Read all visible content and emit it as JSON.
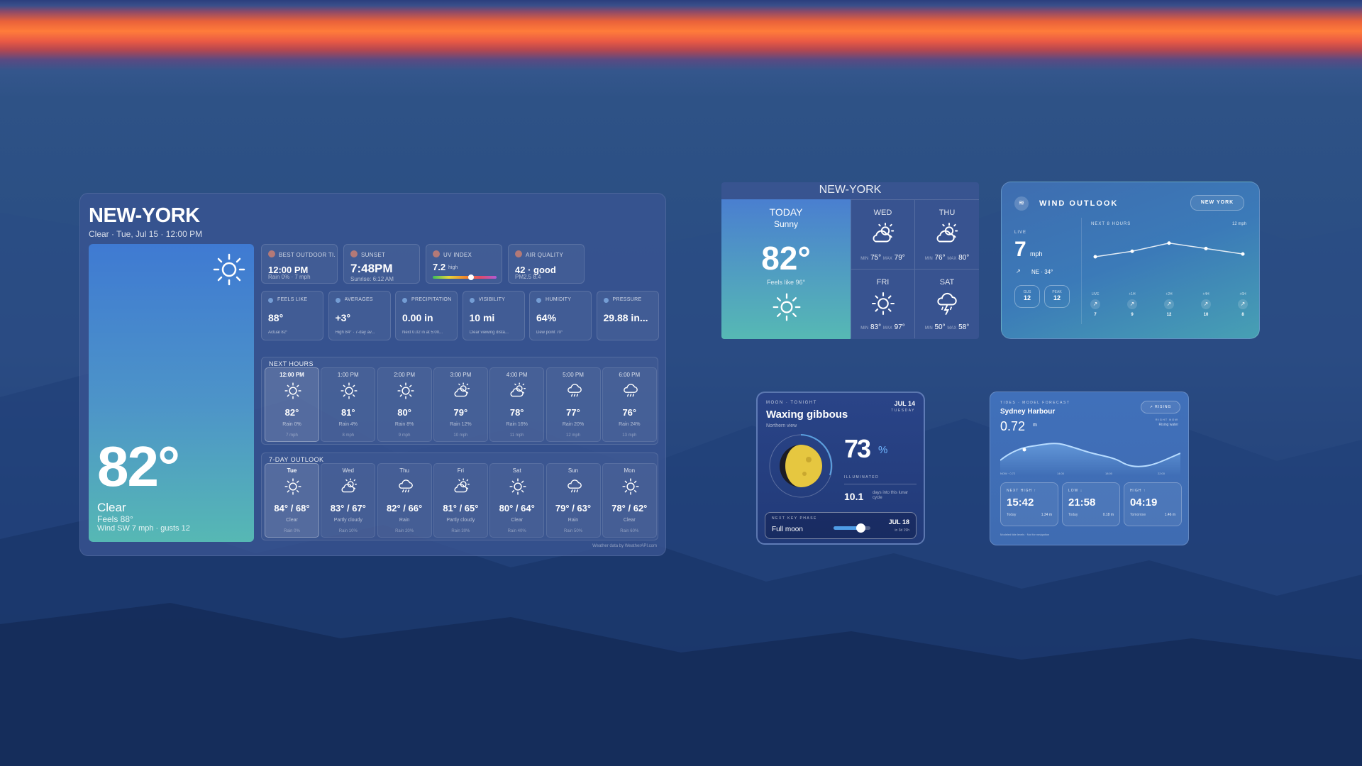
{
  "main": {
    "city": "NEW-YORK",
    "subtitle": "Clear · Tue, Jul 15 · 12:00 PM",
    "hero": {
      "temp": "82°",
      "condition": "Clear",
      "feels": "Feels 88°",
      "wind": "Wind SW 7 mph · gusts 12"
    },
    "tiles_top": [
      {
        "label": "BEST OUTDOOR TI...",
        "value": "12:00 PM",
        "note": "Rain 0% · 7 mph",
        "icon": "runner-icon"
      },
      {
        "label": "SUNSET",
        "value": "7:48PM",
        "note": "Sunrise: 6:12 AM",
        "icon": "sunset-icon"
      },
      {
        "label": "UV INDEX",
        "value": "7.2",
        "qual": "high",
        "uv_level": 0.6,
        "icon": "uv-icon"
      },
      {
        "label": "AIR QUALITY",
        "value": "42 · good",
        "note": "PM2.5 8.4",
        "icon": "air-icon"
      }
    ],
    "tiles_mid": [
      {
        "label": "FEELS LIKE",
        "value": "88°",
        "note": "Actual 82°",
        "icon": "thermometer-icon"
      },
      {
        "label": "AVERAGES",
        "value": "+3°",
        "note": "High 84° · 7-day av...",
        "icon": "chart-icon"
      },
      {
        "label": "PRECIPITATION",
        "value": "0.00 in",
        "note": "Next 0.02 in at 5:00...",
        "icon": "umbrella-icon"
      },
      {
        "label": "VISIBILITY",
        "value": "10 mi",
        "note": "Clear viewing dista...",
        "icon": "eye-icon"
      },
      {
        "label": "HUMIDITY",
        "value": "64%",
        "note": "Dew point 70°",
        "icon": "drop-icon"
      },
      {
        "label": "PRESSURE",
        "value": "29.88 in...",
        "note": "",
        "icon": "gauge-icon"
      }
    ],
    "hourly_title": "NEXT HOURS",
    "hourly": [
      {
        "t": "12:00 PM",
        "temp": "82°",
        "rain": "Rain 0%",
        "wind": "7 mph",
        "icon": "sun"
      },
      {
        "t": "1:00 PM",
        "temp": "81°",
        "rain": "Rain 4%",
        "wind": "8 mph",
        "icon": "sun"
      },
      {
        "t": "2:00 PM",
        "temp": "80°",
        "rain": "Rain 8%",
        "wind": "9 mph",
        "icon": "sun"
      },
      {
        "t": "3:00 PM",
        "temp": "79°",
        "rain": "Rain 12%",
        "wind": "10 mph",
        "icon": "partly"
      },
      {
        "t": "4:00 PM",
        "temp": "78°",
        "rain": "Rain 16%",
        "wind": "11 mph",
        "icon": "partly"
      },
      {
        "t": "5:00 PM",
        "temp": "77°",
        "rain": "Rain 20%",
        "wind": "12 mph",
        "icon": "rain"
      },
      {
        "t": "6:00 PM",
        "temp": "76°",
        "rain": "Rain 24%",
        "wind": "13 mph",
        "icon": "rain"
      }
    ],
    "daily_title": "7-DAY OUTLOOK",
    "daily": [
      {
        "t": "Tue",
        "temp": "84° / 68°",
        "cond": "Clear",
        "rain": "Rain 0%",
        "icon": "sun"
      },
      {
        "t": "Wed",
        "temp": "83° / 67°",
        "cond": "Partly cloudy",
        "rain": "Rain 10%",
        "icon": "partly"
      },
      {
        "t": "Thu",
        "temp": "82° / 66°",
        "cond": "Rain",
        "rain": "Rain 20%",
        "icon": "rain"
      },
      {
        "t": "Fri",
        "temp": "81° / 65°",
        "cond": "Partly cloudy",
        "rain": "Rain 30%",
        "icon": "partly"
      },
      {
        "t": "Sat",
        "temp": "80° / 64°",
        "cond": "Clear",
        "rain": "Rain 40%",
        "icon": "sun"
      },
      {
        "t": "Sun",
        "temp": "79° / 63°",
        "cond": "Rain",
        "rain": "Rain 50%",
        "icon": "rain"
      },
      {
        "t": "Mon",
        "temp": "78° / 62°",
        "cond": "Clear",
        "rain": "Rain 60%",
        "icon": "sun"
      }
    ],
    "credit": "Weather data by WeatherAPI.com"
  },
  "forecast": {
    "city": "NEW-YORK",
    "today_label": "TODAY",
    "today_cond": "Sunny",
    "today_temp": "82°",
    "feels": "Feels like 96°",
    "min_label": "MIN",
    "max_label": "MAX",
    "days": [
      {
        "d": "WED",
        "min": "75°",
        "max": "79°",
        "icon": "partly"
      },
      {
        "d": "THU",
        "min": "76°",
        "max": "80°",
        "icon": "partly"
      },
      {
        "d": "FRI",
        "min": "83°",
        "max": "97°",
        "icon": "sun"
      },
      {
        "d": "SAT",
        "min": "50°",
        "max": "58°",
        "icon": "storm"
      }
    ]
  },
  "wind": {
    "title": "WIND OUTLOOK",
    "city_pill": "NEW YORK",
    "live_label": "LIVE",
    "speed": "7",
    "unit": "mph",
    "dir": "NE · 34°",
    "gust_label": "GUS",
    "gust": "12",
    "peak_label": "PEAK",
    "peak": "12",
    "next_label": "NEXT 8 HOURS",
    "max_label": "12 mph",
    "cols": [
      {
        "h": "LIVE",
        "v": "7"
      },
      {
        "h": "+1H",
        "v": "9"
      },
      {
        "h": "+2H",
        "v": "12"
      },
      {
        "h": "+4H",
        "v": "10"
      },
      {
        "h": "+6H",
        "v": "8"
      }
    ],
    "series": [
      7,
      9,
      12,
      10,
      8
    ]
  },
  "moon": {
    "label": "MOON · TONIGHT",
    "date": "JUL 14",
    "weekday": "TUESDAY",
    "phase": "Waxing gibbous",
    "sublabel": "Northern view",
    "illum": "73",
    "pct": "%",
    "illum_label": "ILLUMINATED",
    "days": "10.1",
    "days_note": "days into this lunar cycle",
    "next_label": "NEXT KEY PHASE",
    "next_phase": "Full moon",
    "next_date": "JUL 18",
    "next_note": "in 3d 19h",
    "progress": 0.73
  },
  "tides": {
    "label": "TIDES · MODEL FORECAST",
    "place": "Sydney Harbour",
    "now": "0.72",
    "unit": "m",
    "rising": "RISING",
    "right_note1": "RIGHT NOW",
    "right_note2": "Rising water",
    "axis": [
      "NOW · 0.72",
      "14:00",
      "18:00",
      "22:00"
    ],
    "boxes": [
      {
        "h": "NEXT HIGH ↑",
        "time": "15:42",
        "day": "Today",
        "m": "1.34 m"
      },
      {
        "h": "LOW ↓",
        "time": "21:58",
        "day": "Today",
        "m": "0.18 m"
      },
      {
        "h": "HIGH ↑",
        "time": "04:19",
        "day": "Tomorrow",
        "m": "1.46 m"
      }
    ],
    "footer": "Modeled tide levels · Not for navigation"
  }
}
